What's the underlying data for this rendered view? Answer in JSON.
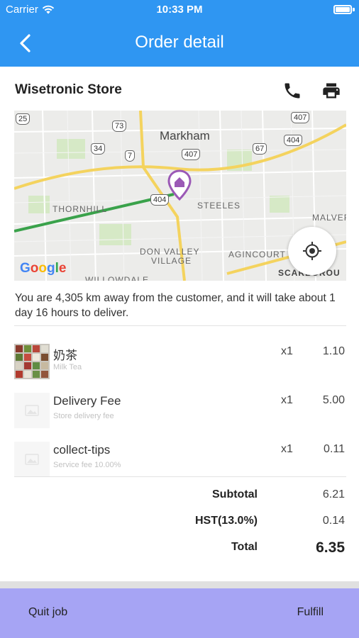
{
  "status_bar": {
    "carrier": "Carrier",
    "time": "10:33 PM"
  },
  "nav": {
    "title": "Order detail",
    "back_icon": "chevron-left-icon"
  },
  "store": {
    "name": "Wisetronic Store",
    "call_icon": "phone-icon",
    "print_icon": "printer-icon"
  },
  "map": {
    "city": "Markham",
    "labels": [
      "THORNHILL",
      "STEELES",
      "DON VALLEY",
      "VILLAGE",
      "AGINCOURT",
      "MALVER",
      "SCARBOROU",
      "WILLOWDALE"
    ],
    "highway_shields": [
      "25",
      "73",
      "34",
      "7",
      "407",
      "67",
      "404",
      "404",
      "407"
    ],
    "attribution": "Google",
    "locate_icon": "my-location-icon",
    "pin_icon": "home-pin-icon",
    "route_color": "#3aa24b",
    "pin_color": "#9b59b6"
  },
  "distance_message": "You are 4,305 km away from the customer, and it will take about 1 day 16 hours to deliver.",
  "items": [
    {
      "name": "奶茶",
      "desc": "Milk Tea",
      "qty": "x1",
      "price": "1.10",
      "has_photo": true
    },
    {
      "name": "Delivery Fee",
      "desc": "Store delivery fee",
      "qty": "x1",
      "price": "5.00",
      "has_photo": false
    },
    {
      "name": "collect-tips",
      "desc": "Service fee 10.00%",
      "qty": "x1",
      "price": "0.11",
      "has_photo": false
    }
  ],
  "summary": {
    "subtotal_label": "Subtotal",
    "subtotal_value": "6.21",
    "tax_label": "HST(13.0%)",
    "tax_value": "0.14",
    "total_label": "Total",
    "total_value": "6.35"
  },
  "actions": {
    "quit_label": "Quit job",
    "fulfill_label": "Fulfill"
  },
  "colors": {
    "primary": "#2f96f2",
    "bottom_bar": "#a6a4f4"
  }
}
